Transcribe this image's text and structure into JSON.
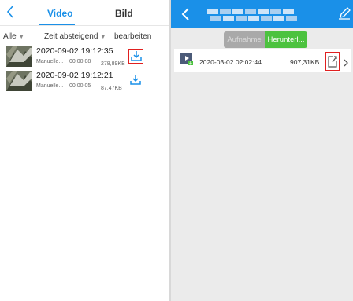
{
  "left_panel": {
    "tabs": [
      {
        "label": "Video",
        "active": true
      },
      {
        "label": "Bild",
        "active": false
      }
    ],
    "filters": {
      "all_label": "Alle",
      "sort_label": "Zeit absteigend",
      "edit_label": "bearbeiten"
    },
    "recordings": [
      {
        "datetime": "2020-09-02 19:12:35",
        "type": "Manuelle...",
        "duration": "00:00:08",
        "size": "278,89KB",
        "highlighted": true
      },
      {
        "datetime": "2020-09-02 19:12:21",
        "type": "Manuelle...",
        "duration": "00:00:05",
        "size": "87,47KB",
        "highlighted": false
      }
    ],
    "accent_color": "#1a90e8"
  },
  "right_panel": {
    "segments": [
      {
        "label": "Aufnahme",
        "active": false
      },
      {
        "label": "Herunterl...",
        "active": true
      }
    ],
    "files": [
      {
        "datetime": "2020-03-02 02:02:44",
        "size": "907,31KB"
      }
    ],
    "header_color": "#1a90e8",
    "active_segment_color": "#4cc23f"
  },
  "icons": {
    "back": "chevron-left-icon",
    "download": "download-icon",
    "edit": "pencil-icon",
    "share": "share-icon",
    "video_file": "video-file-icon"
  }
}
